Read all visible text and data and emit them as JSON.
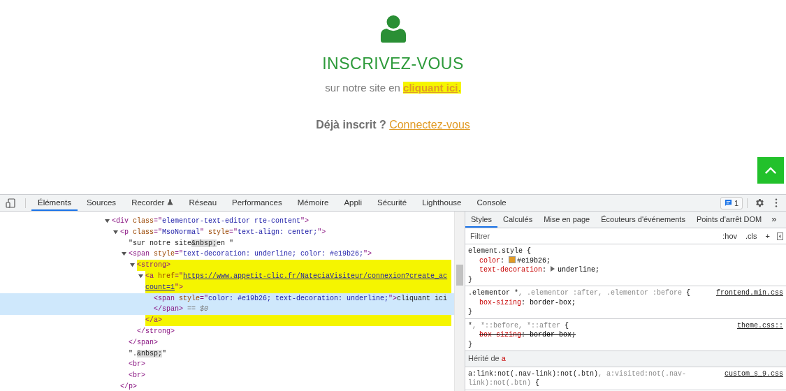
{
  "page": {
    "heading": "INSCRIVEZ-VOUS",
    "intro": {
      "text": "sur notre site en ",
      "link": "cliquant ici",
      "after": ".",
      "highlighted": true
    },
    "login": {
      "text": "Déjà inscrit ?",
      "link": "Connectez-vous"
    }
  },
  "devtools": {
    "tabs": [
      {
        "label": "Éléments",
        "selected": true,
        "has_icon": false
      },
      {
        "label": "Sources",
        "selected": false,
        "has_icon": false
      },
      {
        "label": "Recorder",
        "selected": false,
        "has_icon": true
      },
      {
        "label": "Réseau",
        "selected": false,
        "has_icon": false
      },
      {
        "label": "Performances",
        "selected": false,
        "has_icon": false
      },
      {
        "label": "Mémoire",
        "selected": false,
        "has_icon": false
      },
      {
        "label": "Appli",
        "selected": false,
        "has_icon": false
      },
      {
        "label": "Sécurité",
        "selected": false,
        "has_icon": false
      },
      {
        "label": "Lighthouse",
        "selected": false,
        "has_icon": false
      },
      {
        "label": "Console",
        "selected": false,
        "has_icon": false
      }
    ],
    "issues_count": "1",
    "dom_tree": [
      {
        "open": [
          {
            "kind": "tag",
            "text": "<div"
          },
          {
            "kind": "attr",
            "text": " class"
          },
          {
            "kind": "tag",
            "text": "=\""
          },
          {
            "kind": "value",
            "text": "elementor-text-editor rte-content"
          },
          {
            "kind": "tag",
            "text": "\">"
          }
        ],
        "expanded": true,
        "children": [
          {
            "open": [
              {
                "kind": "tag",
                "text": "<p"
              },
              {
                "kind": "attr",
                "text": " class"
              },
              {
                "kind": "tag",
                "text": "=\""
              },
              {
                "kind": "value",
                "text": "MsoNormal"
              },
              {
                "kind": "tag",
                "text": "\""
              },
              {
                "kind": "attr",
                "text": " style"
              },
              {
                "kind": "tag",
                "text": "=\""
              },
              {
                "kind": "value",
                "text": "text-align: center;"
              },
              {
                "kind": "tag",
                "text": "\">"
              }
            ],
            "expanded": true,
            "close": [
              {
                "kind": "tag",
                "text": "</p>"
              }
            ],
            "children": [
              {
                "open": [
                  {
                    "kind": "text",
                    "text": "\"sur notre site"
                  },
                  {
                    "kind": "entity",
                    "text": "&nbsp;"
                  },
                  {
                    "kind": "text",
                    "text": "en \""
                  }
                ]
              },
              {
                "open": [
                  {
                    "kind": "tag",
                    "text": "<span"
                  },
                  {
                    "kind": "attr",
                    "text": " style"
                  },
                  {
                    "kind": "tag",
                    "text": "=\""
                  },
                  {
                    "kind": "value",
                    "text": "text-decoration: underline; color: #e19b26;"
                  },
                  {
                    "kind": "tag",
                    "text": "\">"
                  }
                ],
                "expanded": true,
                "close": [
                  {
                    "kind": "tag",
                    "text": "</span>"
                  }
                ],
                "children": [
                  {
                    "open": [
                      {
                        "kind": "tag",
                        "text": "<strong>"
                      }
                    ],
                    "expanded": true,
                    "highlighted": true,
                    "close": [
                      {
                        "kind": "tag",
                        "text": "</strong>"
                      }
                    ],
                    "children": [
                      {
                        "open": [
                          {
                            "kind": "tag",
                            "text": "<a"
                          },
                          {
                            "kind": "attr",
                            "text": " href"
                          },
                          {
                            "kind": "tag",
                            "text": "=\""
                          },
                          {
                            "kind": "link",
                            "text": "https://www.appetit-clic.fr/NateciaVisiteur/connexion?create_account=1"
                          },
                          {
                            "kind": "tag",
                            "text": "\">"
                          }
                        ],
                        "expanded": true,
                        "highlighted": true,
                        "close": [
                          {
                            "kind": "tag",
                            "text": "</a>"
                          }
                        ],
                        "close_highlighted": true,
                        "children": [
                          {
                            "open": [
                              {
                                "kind": "tag",
                                "text": "<span"
                              },
                              {
                                "kind": "attr",
                                "text": " style"
                              },
                              {
                                "kind": "tag",
                                "text": "=\""
                              },
                              {
                                "kind": "value",
                                "text": "color: #e19b26; text-decoration: underline;"
                              },
                              {
                                "kind": "tag",
                                "text": "\">"
                              },
                              {
                                "kind": "text",
                                "text": "cliquant ici "
                              },
                              {
                                "kind": "tag",
                                "text": "</span>"
                              },
                              {
                                "kind": "muted",
                                "text": " == $0"
                              }
                            ],
                            "selected": true
                          }
                        ]
                      }
                    ]
                  }
                ]
              },
              {
                "open": [
                  {
                    "kind": "text",
                    "text": "\"."
                  },
                  {
                    "kind": "entity",
                    "text": "&nbsp;"
                  },
                  {
                    "kind": "text",
                    "text": "\""
                  }
                ]
              },
              {
                "open": [
                  {
                    "kind": "tag",
                    "text": "<br>"
                  }
                ]
              },
              {
                "open": [
                  {
                    "kind": "tag",
                    "text": "<br>"
                  }
                ]
              }
            ]
          }
        ]
      }
    ],
    "side_tabs": [
      {
        "label": "Styles",
        "selected": true
      },
      {
        "label": "Calculés",
        "selected": false
      },
      {
        "label": "Mise en page",
        "selected": false
      },
      {
        "label": "Écouteurs d'événements",
        "selected": false
      },
      {
        "label": "Points d'arrêt DOM",
        "selected": false
      }
    ],
    "more_tabs": "»",
    "filter": {
      "placeholder": "Filtrer"
    },
    "filter_buttons": [
      ":hov",
      ".cls",
      "+"
    ],
    "rules": [
      {
        "kind": "rule",
        "selector": [
          {
            "matched": true,
            "text": "element.style"
          }
        ],
        "open_brace": "{",
        "close_brace": "}",
        "declarations": [
          {
            "property": "color",
            "colon": ":",
            "value": "#e19b26;",
            "struck": false,
            "color": "#e19b26",
            "expandable": false
          },
          {
            "property": "text-decoration",
            "colon": ":",
            "value": "underline;",
            "struck": false,
            "expandable": true
          }
        ]
      },
      {
        "kind": "rule",
        "selector": [
          {
            "matched": true,
            "text": ".elementor *"
          },
          {
            "matched": false,
            "text": ", .elementor :after, .elementor :before"
          }
        ],
        "open_brace": "{",
        "close_brace": "}",
        "source": "frontend.min.css",
        "declarations": [
          {
            "property": "box-sizing",
            "colon": ":",
            "value": "border-box;",
            "struck": false,
            "expandable": false
          }
        ]
      },
      {
        "kind": "rule",
        "selector": [
          {
            "matched": true,
            "text": "*"
          },
          {
            "matched": false,
            "text": ", *::before, *::after"
          }
        ],
        "open_brace": "{",
        "close_brace": "}",
        "source": "theme.css::",
        "declarations": [
          {
            "property": "box-sizing",
            "colon": ":",
            "value": "border-box;",
            "struck": true,
            "expandable": false
          }
        ]
      },
      {
        "kind": "inherited",
        "label": "Hérité de",
        "element": "a"
      },
      {
        "kind": "rule",
        "selector": [
          {
            "matched": true,
            "text": "a:link:not(.nav-link):not(.btn)"
          },
          {
            "matched": false,
            "text": ", a:visited:not(.nav-link):not(.btn)"
          }
        ],
        "open_brace": "{",
        "source": "custom_s_9.css"
      }
    ]
  }
}
